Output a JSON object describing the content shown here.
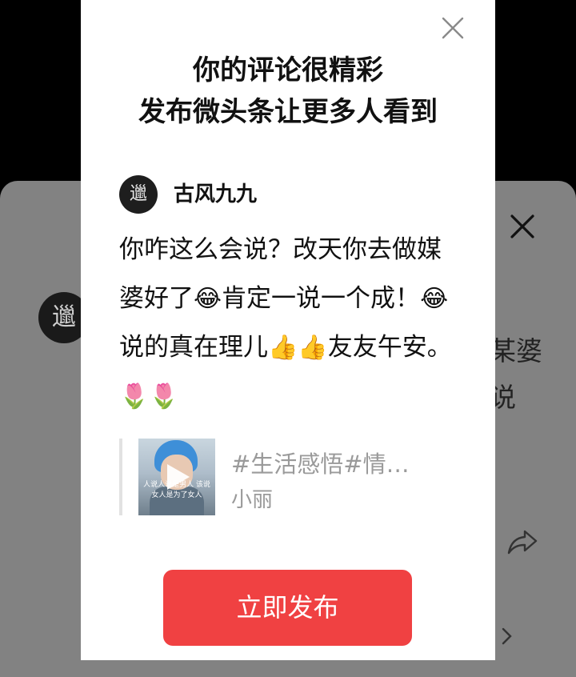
{
  "background": {
    "avatar_glyph": "邋",
    "text_line1": "某婆",
    "text_line2": "说",
    "icons": [
      "close-icon",
      "share-icon",
      "chevron-right-icon"
    ]
  },
  "modal": {
    "title_line1": "你的评论很精彩",
    "title_line2": "发布微头条让更多人看到",
    "author": {
      "avatar_glyph": "邋",
      "name": "古风九九"
    },
    "comment": {
      "p1": "你咋这么会说？改天你去做媒婆好了",
      "e1": "😂",
      "p2": "肯定一说一个成！",
      "e2": "😂",
      "p3": "说的真在理儿",
      "e3": "👍",
      "e4": "👍",
      "p4": "友友午安。",
      "e5": "🌷🌷"
    },
    "quote": {
      "title": "#生活感悟#情…",
      "subtitle": "小丽",
      "thumb_caption": "人说人说是男人 该说女人是为了女人"
    },
    "publish_label": "立即发布"
  },
  "colors": {
    "accent": "#f04142",
    "overlay": "#828282",
    "muted_text": "#9a9a9a"
  }
}
